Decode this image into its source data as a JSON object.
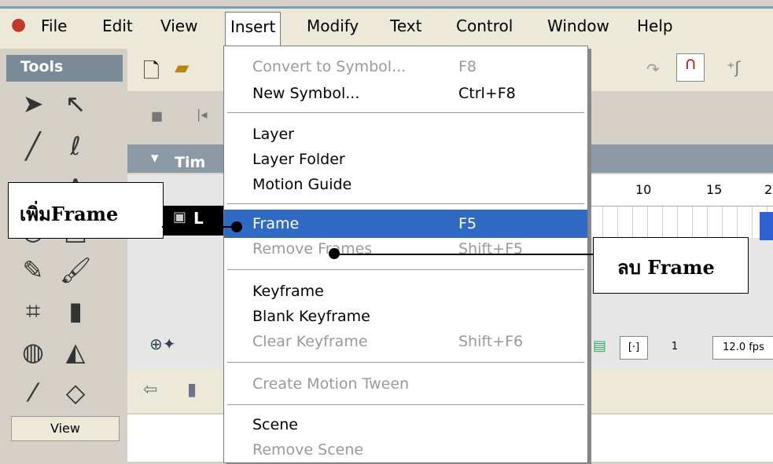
{
  "menubar": {
    "items": [
      "File",
      "Edit",
      "View",
      "Insert",
      "Modify",
      "Text",
      "Control",
      "Window",
      "Help"
    ]
  },
  "tools": {
    "title": "Tools",
    "view_label": "View"
  },
  "timeline": {
    "title": "Tim",
    "layer_label": "L",
    "ruler": [
      "10",
      "15",
      "2"
    ],
    "frame_number": "1",
    "fps": "12.0 fps"
  },
  "insert_menu": {
    "items": [
      {
        "label": "Convert to Symbol...",
        "shortcut": "F8",
        "disabled": true
      },
      {
        "label": "New Symbol...",
        "shortcut": "Ctrl+F8",
        "disabled": false
      },
      {
        "label": "Layer",
        "shortcut": "",
        "disabled": false
      },
      {
        "label": "Layer Folder",
        "shortcut": "",
        "disabled": false
      },
      {
        "label": "Motion Guide",
        "shortcut": "",
        "disabled": false
      },
      {
        "label": "Frame",
        "shortcut": "F5",
        "disabled": false,
        "highlighted": true
      },
      {
        "label": "Remove Frames",
        "shortcut": "Shift+F5",
        "disabled": true
      },
      {
        "label": "Keyframe",
        "shortcut": "",
        "disabled": false
      },
      {
        "label": "Blank Keyframe",
        "shortcut": "",
        "disabled": false
      },
      {
        "label": "Clear Keyframe",
        "shortcut": "Shift+F6",
        "disabled": true
      },
      {
        "label": "Create Motion Tween",
        "shortcut": "",
        "disabled": true
      },
      {
        "label": "Scene",
        "shortcut": "",
        "disabled": false
      },
      {
        "label": "Remove Scene",
        "shortcut": "",
        "disabled": true
      }
    ]
  },
  "annotations": {
    "add_frame": "เพิ่มFrame",
    "remove_frame": "ลบ Frame"
  }
}
